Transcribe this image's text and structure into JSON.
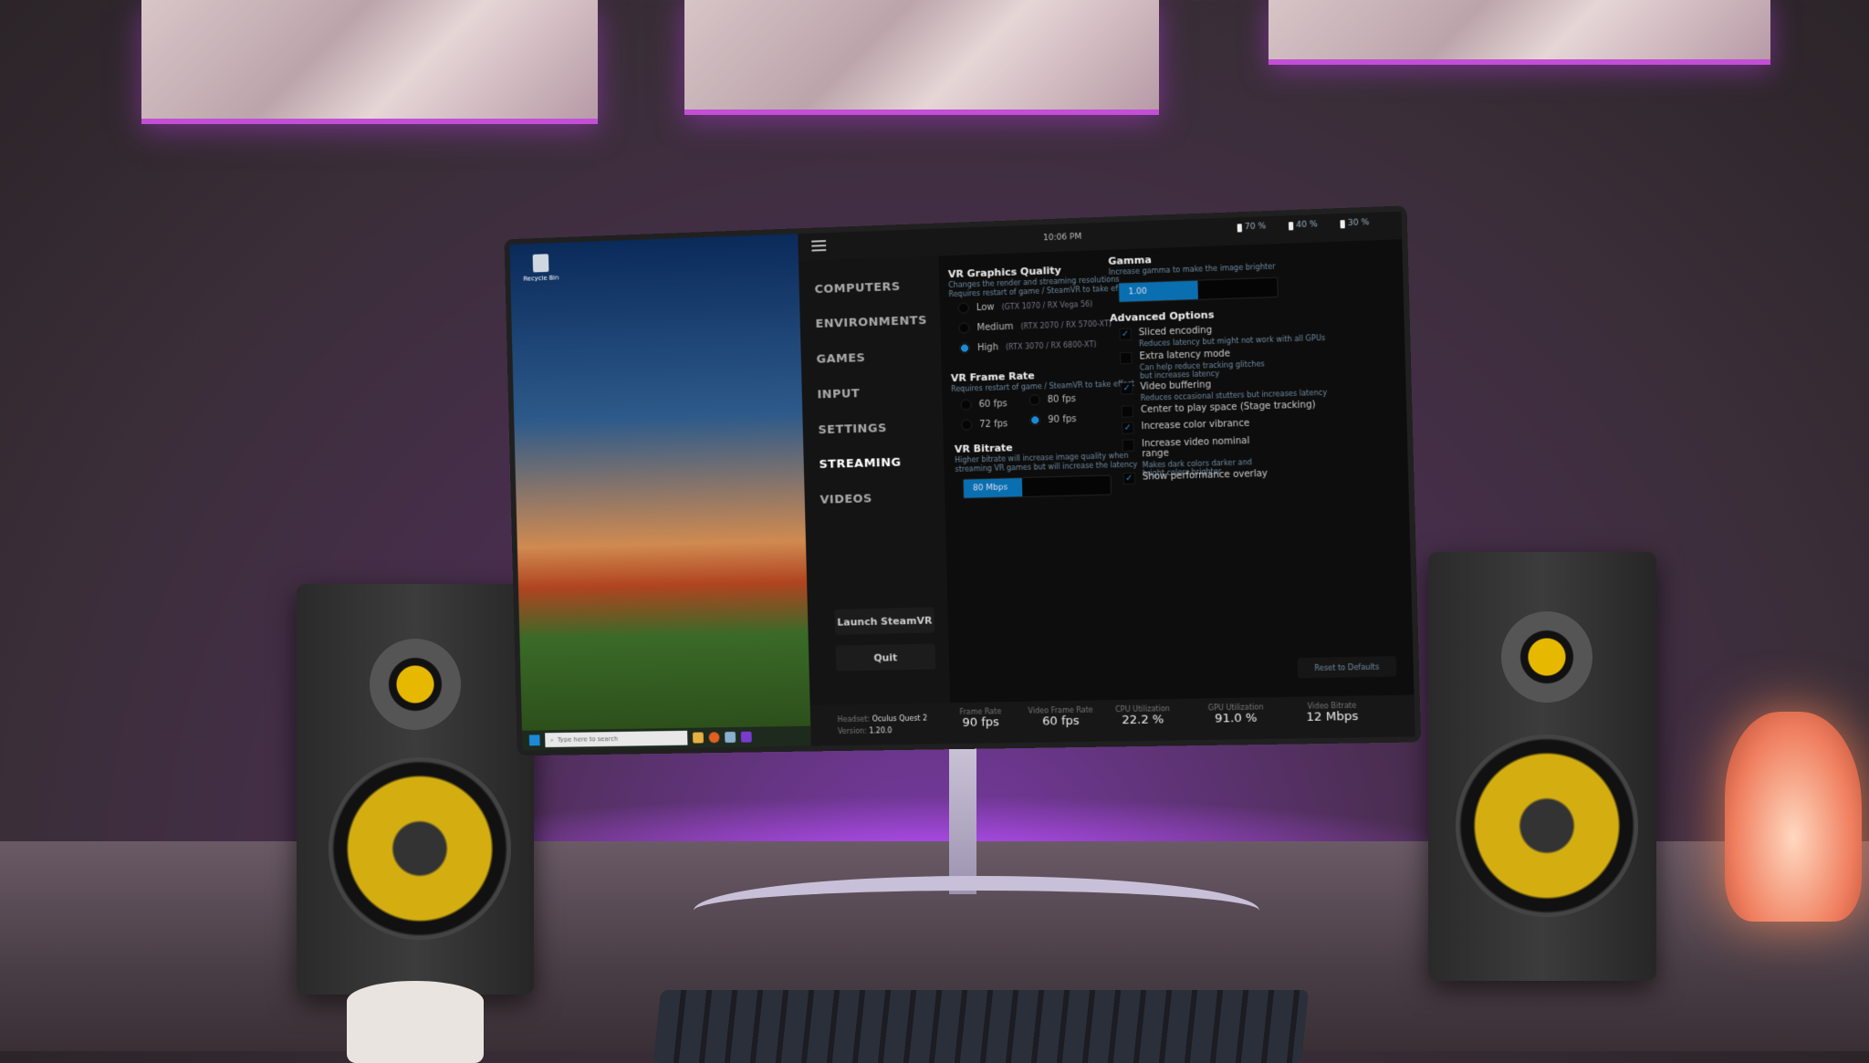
{
  "desktop": {
    "recycle_bin_label": "Recycle Bin",
    "taskbar_search_placeholder": "Type here to search"
  },
  "app": {
    "topbar": {
      "time": "10:06 PM",
      "batteries": [
        "70 %",
        "40 %",
        "30 %"
      ]
    },
    "sidebar": {
      "items": [
        {
          "label": "COMPUTERS",
          "active": false
        },
        {
          "label": "ENVIRONMENTS",
          "active": false
        },
        {
          "label": "GAMES",
          "active": false
        },
        {
          "label": "INPUT",
          "active": false
        },
        {
          "label": "SETTINGS",
          "active": false
        },
        {
          "label": "STREAMING",
          "active": true
        },
        {
          "label": "VIDEOS",
          "active": false
        }
      ],
      "launch_button": "Launch SteamVR",
      "quit_button": "Quit"
    },
    "graphics_quality": {
      "title": "VR Graphics Quality",
      "description_line1": "Changes the render and streaming resolutions",
      "description_line2": "Requires restart of game / SteamVR to take effect",
      "options": [
        {
          "label": "Low",
          "hint": "(GTX 1070 / RX Vega 56)",
          "selected": false
        },
        {
          "label": "Medium",
          "hint": "(RTX 2070 / RX 5700-XT)",
          "selected": false
        },
        {
          "label": "High",
          "hint": "(RTX 3070 / RX 6800-XT)",
          "selected": true
        }
      ]
    },
    "frame_rate": {
      "title": "VR Frame Rate",
      "description": "Requires restart of game / SteamVR to take effect",
      "options": [
        {
          "label": "60 fps",
          "selected": false
        },
        {
          "label": "80 fps",
          "selected": false
        },
        {
          "label": "72 fps",
          "selected": false
        },
        {
          "label": "90 fps",
          "selected": true
        }
      ]
    },
    "bitrate": {
      "title": "VR Bitrate",
      "description_line1": "Higher bitrate will increase image quality when",
      "description_line2": "streaming VR games but will increase the latency",
      "value_label": "80 Mbps",
      "fill_fraction": 0.4
    },
    "gamma": {
      "title": "Gamma",
      "description": "Increase gamma to make the image brighter",
      "value_label": "1.00",
      "fill_fraction": 0.5
    },
    "advanced": {
      "title": "Advanced Options",
      "options": [
        {
          "label": "Sliced encoding",
          "desc": "Reduces latency but might not work with all GPUs",
          "checked": true
        },
        {
          "label": "Extra latency mode",
          "desc": "Can help reduce tracking glitches but increases latency",
          "checked": false
        },
        {
          "label": "Video buffering",
          "desc": "Reduces occasional stutters but increases latency",
          "checked": true
        },
        {
          "label": "Center to play space (Stage tracking)",
          "desc": "",
          "checked": false
        },
        {
          "label": "Increase color vibrance",
          "desc": "",
          "checked": true
        },
        {
          "label": "Increase video nominal range",
          "desc": "Makes dark colors darker and bright colors brighter",
          "checked": false
        },
        {
          "label": "Show performance overlay",
          "desc": "",
          "checked": true
        }
      ],
      "check_glyph": "✓"
    },
    "reset_button": "Reset to Defaults",
    "status": {
      "headset_label": "Headset:",
      "headset_value": "Oculus Quest 2",
      "version_label": "Version:",
      "version_value": "1.20.0",
      "stats": [
        {
          "label": "Frame Rate",
          "value": "90 fps"
        },
        {
          "label": "Video Frame Rate",
          "value": "60 fps"
        },
        {
          "label": "CPU Utilization",
          "value": "22.2 %"
        },
        {
          "label": "GPU Utilization",
          "value": "91.0 %"
        },
        {
          "label": "Video Bitrate",
          "value": "12 Mbps"
        }
      ]
    },
    "accent_color": "#0a6fb0"
  }
}
